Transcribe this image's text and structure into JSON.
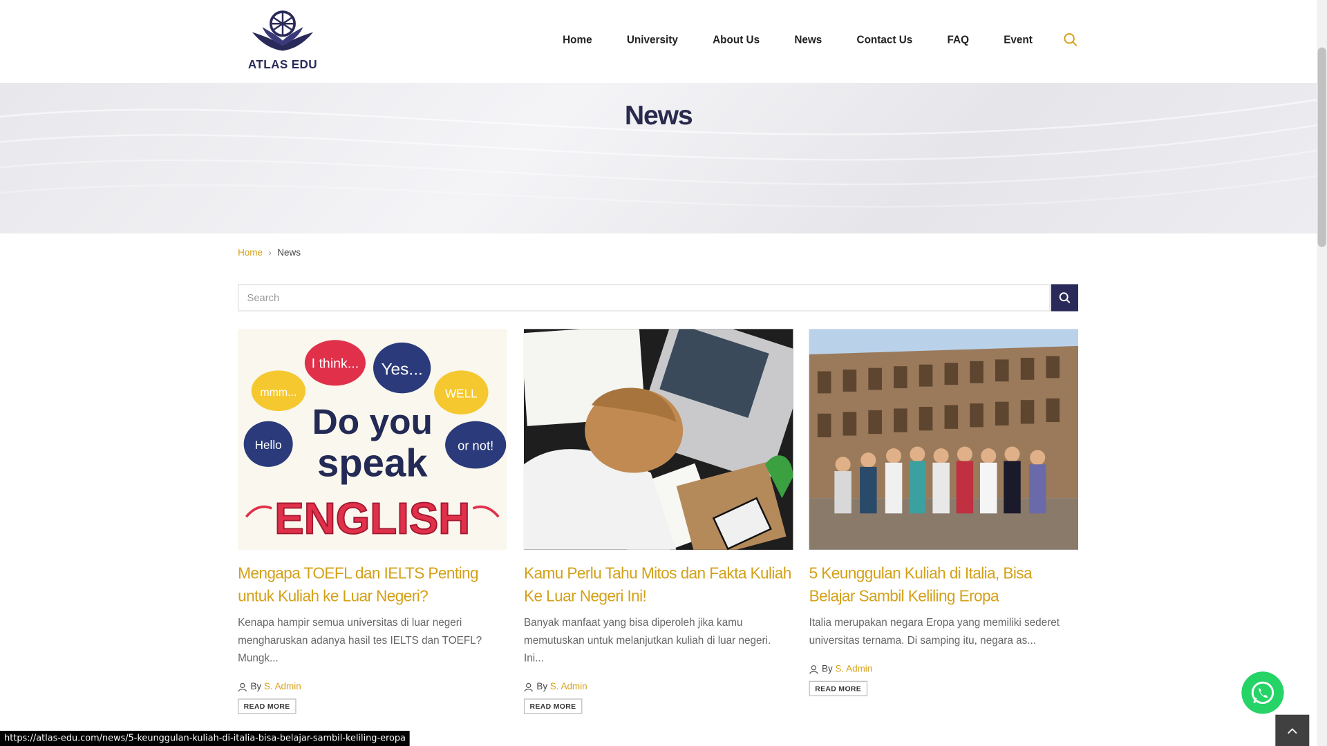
{
  "header": {
    "logo_text": "ATLAS EDU",
    "nav": [
      "Home",
      "University",
      "About Us",
      "News",
      "Contact Us",
      "FAQ",
      "Event"
    ],
    "search_icon": "search-icon"
  },
  "hero": {
    "title": "News"
  },
  "breadcrumb": {
    "home": "Home",
    "separator": "chevron-right-icon",
    "current": "News"
  },
  "search": {
    "placeholder": "Search",
    "value": ""
  },
  "posts": [
    {
      "title": "Mengapa TOEFL dan IELTS Penting untuk Kuliah ke Luar Negeri?",
      "excerpt": "Kenapa hampir semua universitas di luar negeri mengharuskan adanya hasil tes IELTS dan TOEFL? Mungk...",
      "by": "By",
      "author": "S. Admin",
      "read_more": "READ MORE",
      "image": {
        "bubbles": [
          "I think...",
          "Yes...",
          "mmm...",
          "WELL",
          "Hello",
          "or not!"
        ],
        "headline_1": "Do you",
        "headline_2": "speak",
        "headline_3": "ENGLISH"
      }
    },
    {
      "title": "Kamu Perlu Tahu Mitos dan Fakta Kuliah Ke Luar Negeri Ini!",
      "excerpt": "Banyak manfaat yang bisa diperoleh jika kamu memutuskan untuk melanjutkan kuliah di luar negeri. Ini...",
      "by": "By",
      "author": "S. Admin",
      "read_more": "READ MORE"
    },
    {
      "title": "5 Keunggulan Kuliah di Italia, Bisa Belajar Sambil Keliling Eropa",
      "excerpt": "Italia merupakan negara Eropa yang memiliki sederet universitas ternama. Di samping itu, negara as...",
      "by": "By",
      "author": "S. Admin",
      "read_more": "READ MORE"
    }
  ],
  "status_bar": {
    "url": "https://atlas-edu.com/news/5-keunggulan-kuliah-di-italia-bisa-belajar-sambil-keliling-eropa"
  },
  "colors": {
    "accent": "#d4a017",
    "navy": "#2a2a5a",
    "whatsapp": "#25d366"
  }
}
